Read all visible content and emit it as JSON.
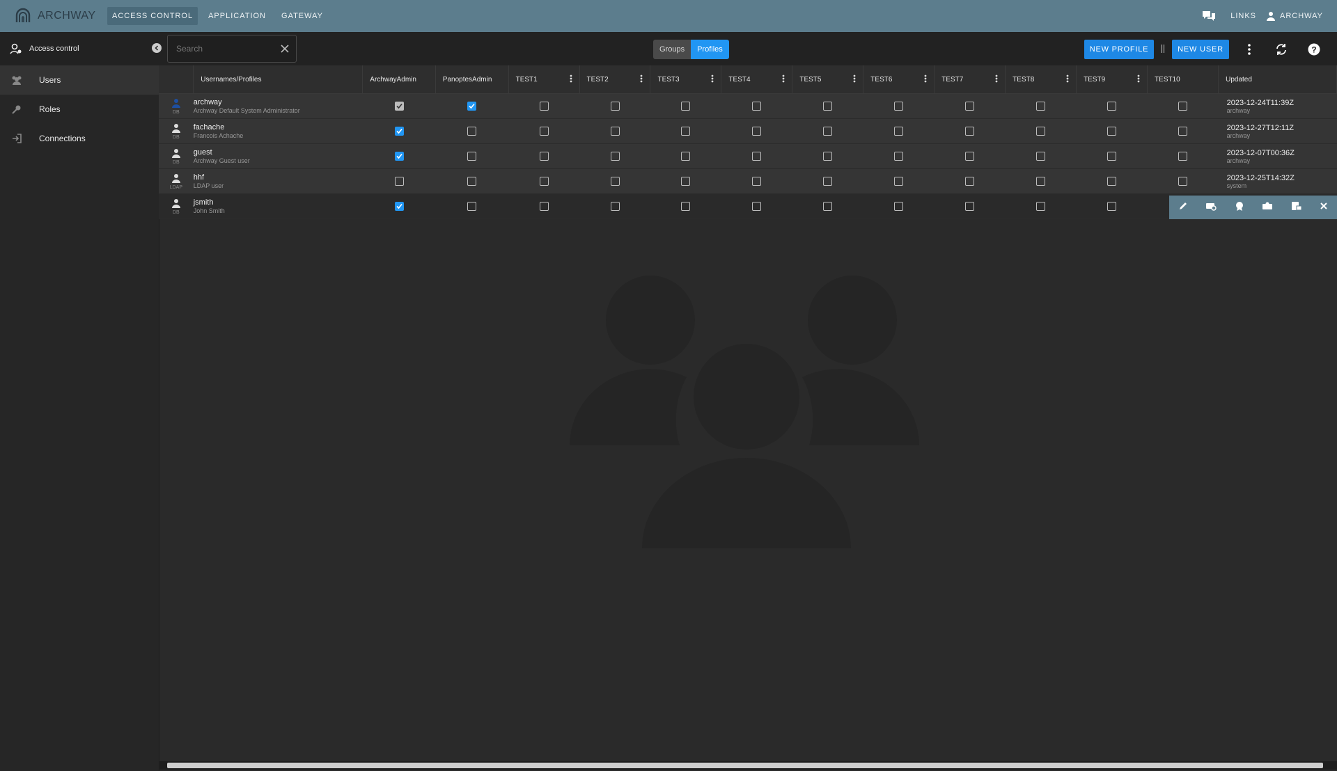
{
  "brand": {
    "name": "ARCHWAY"
  },
  "topnav": {
    "items": [
      {
        "label": "ACCESS CONTROL",
        "active": true
      },
      {
        "label": "APPLICATION",
        "active": false
      },
      {
        "label": "GATEWAY",
        "active": false
      }
    ],
    "links_label": "LINKS",
    "user_label": "ARCHWAY"
  },
  "sidebar": {
    "title": "Access control",
    "items": [
      {
        "label": "Users",
        "icon": "users-icon",
        "active": true
      },
      {
        "label": "Roles",
        "icon": "key-icon",
        "active": false
      },
      {
        "label": "Connections",
        "icon": "login-icon",
        "active": false
      }
    ]
  },
  "search": {
    "placeholder": "Search",
    "value": ""
  },
  "segment": {
    "groups_label": "Groups",
    "profiles_label": "Profiles",
    "selected": "Profiles"
  },
  "toolbar": {
    "new_profile_label": "NEW PROFILE",
    "new_user_label": "NEW USER"
  },
  "table": {
    "columns": [
      "Usernames/Profiles",
      "ArchwayAdmin",
      "PanoptesAdmin",
      "TEST1",
      "TEST2",
      "TEST3",
      "TEST4",
      "TEST5",
      "TEST6",
      "TEST7",
      "TEST8",
      "TEST9",
      "TEST10",
      "Updated"
    ],
    "rows": [
      {
        "username": "archway",
        "description": "Archway Default System Administrator",
        "source": "DB",
        "checks": [
          "grey",
          "on",
          "off",
          "off",
          "off",
          "off",
          "off",
          "off",
          "off",
          "off",
          "off",
          "off"
        ],
        "updated": "2023-12-24T11:39Z",
        "updated_by": "archway"
      },
      {
        "username": "fachache",
        "description": "Francois Achache",
        "source": "DB",
        "checks": [
          "on",
          "off",
          "off",
          "off",
          "off",
          "off",
          "off",
          "off",
          "off",
          "off",
          "off",
          "off"
        ],
        "updated": "2023-12-27T12:11Z",
        "updated_by": "archway"
      },
      {
        "username": "guest",
        "description": "Archway Guest user",
        "source": "DB",
        "checks": [
          "on",
          "off",
          "off",
          "off",
          "off",
          "off",
          "off",
          "off",
          "off",
          "off",
          "off",
          "off"
        ],
        "updated": "2023-12-07T00:36Z",
        "updated_by": "archway"
      },
      {
        "username": "hhf",
        "description": "LDAP user",
        "source": "LDAP",
        "checks": [
          "off",
          "off",
          "off",
          "off",
          "off",
          "off",
          "off",
          "off",
          "off",
          "off",
          "off",
          "off"
        ],
        "updated": "2023-12-25T14:32Z",
        "updated_by": "system"
      },
      {
        "username": "jsmith",
        "description": "John Smith",
        "source": "DB",
        "checks": [
          "on",
          "off",
          "off",
          "off",
          "off",
          "off",
          "off",
          "off",
          "off",
          "off",
          "off",
          ""
        ],
        "updated": "",
        "updated_by": ""
      }
    ]
  },
  "colors": {
    "topbar": "#5c7d8d",
    "accent": "#2196f3"
  }
}
